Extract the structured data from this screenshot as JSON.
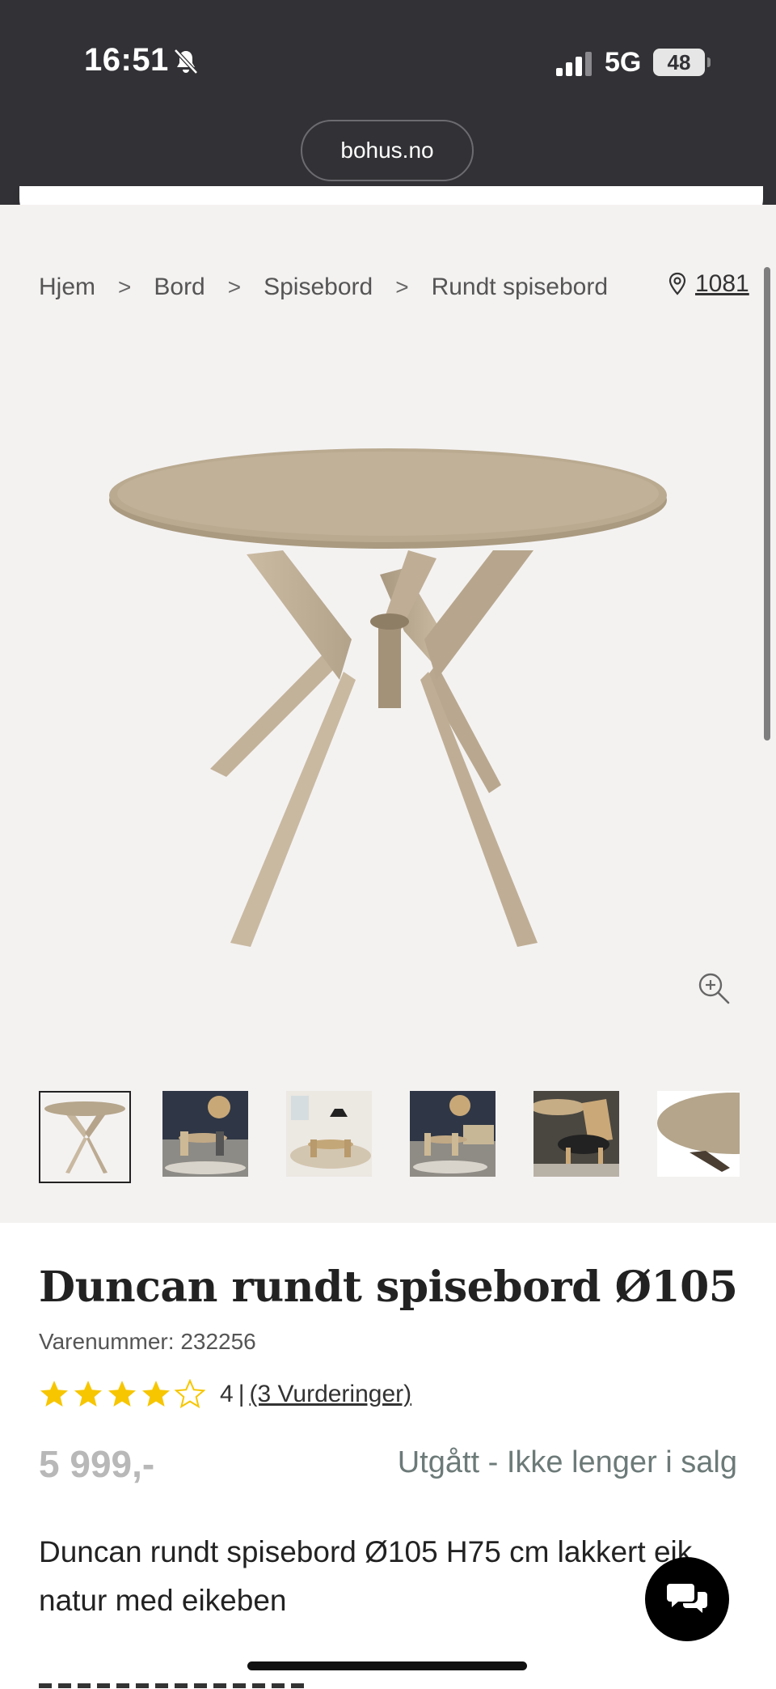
{
  "status_bar": {
    "time": "16:51",
    "network": "5G",
    "battery": "48",
    "icons": [
      "bell-muted-icon",
      "signal-icon"
    ]
  },
  "browser": {
    "url": "bohus.no"
  },
  "breadcrumb": {
    "items": [
      "Hjem",
      "Bord",
      "Spisebord",
      "Rundt spisebord"
    ],
    "separator": ">"
  },
  "store": {
    "label": "1081",
    "icon": "location-pin-icon"
  },
  "gallery": {
    "zoom_icon": "zoom-in-icon",
    "thumbnail_count": 6,
    "active_index": 0
  },
  "product": {
    "title": "Duncan rundt spisebord Ø105",
    "sku": "Varenummer: 232256",
    "rating_value": "4",
    "rating_stars": 4,
    "rating_max": 5,
    "rating_separator": "|",
    "reviews_label": "(3 Vurderinger)",
    "price": "5 999,-",
    "availability": "Utgått - Ikke lenger i salg",
    "description": "Duncan rundt spisebord Ø105 H75 cm lakkert eik natur med eikeben"
  },
  "chat": {
    "icon": "chat-bubbles-icon"
  },
  "colors": {
    "topbar": "#323236",
    "gallery_bg": "#f4f2f1",
    "star": "#f7c600",
    "price_muted": "#b8b8b8",
    "availability": "#6c7a78"
  }
}
